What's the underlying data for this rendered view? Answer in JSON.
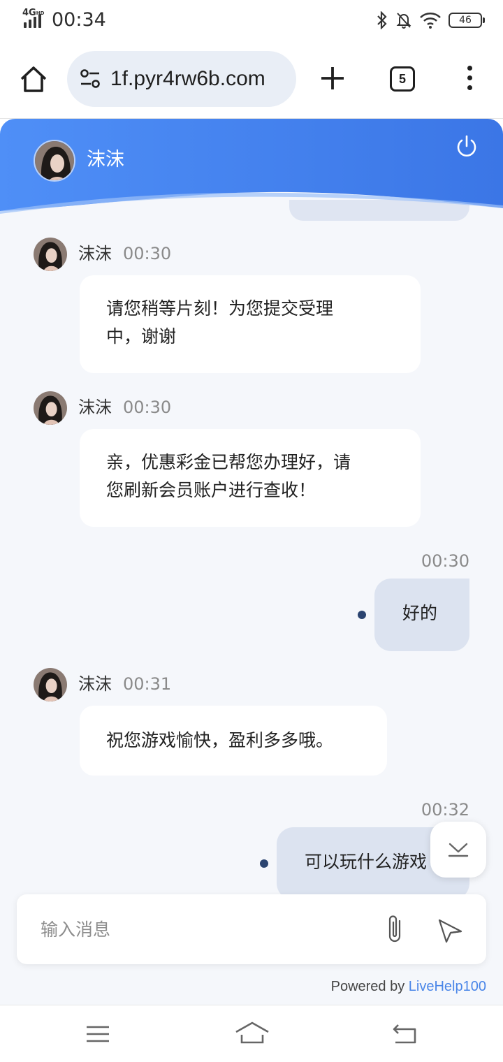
{
  "status_bar": {
    "network": "4G",
    "network_sup": "HD",
    "time": "00:34",
    "battery": "46"
  },
  "browser": {
    "url": "1f.pyr4rw6b.com",
    "tab_count": "5"
  },
  "chat": {
    "agent_name": "沫沫",
    "messages": [
      {
        "sender": "沫沫",
        "time": "00:30",
        "text": "请您稍等片刻！为您提交受理中，谢谢",
        "line1": "请您稍等片刻！为您提交受理",
        "line2": "中，谢谢"
      },
      {
        "sender": "沫沫",
        "time": "00:30",
        "text": "亲，优惠彩金已帮您办理好，请您刷新会员账户进行查收！",
        "line1": "亲，优惠彩金已帮您办理好，请",
        "line2": "您刷新会员账户进行查收！"
      },
      {
        "sender": "me",
        "time": "00:30",
        "text": "好的"
      },
      {
        "sender": "沫沫",
        "time": "00:31",
        "text": "祝您游戏愉快，盈利多多哦。"
      },
      {
        "sender": "me",
        "time": "00:32",
        "text": "可以玩什么游戏"
      }
    ],
    "input_placeholder": "输入消息",
    "powered_by": "Powered by",
    "powered_brand": "LiveHelp100"
  },
  "colors": {
    "header_gradient_start": "#4f8ff7",
    "header_gradient_end": "#3b76e6",
    "outgoing_bubble": "#dce3f0",
    "brand_link": "#4a86e8"
  },
  "icons": [
    "home-icon",
    "site-settings-icon",
    "plus-icon",
    "tabs-icon",
    "more-icon",
    "power-icon",
    "scroll-down-icon",
    "attach-icon",
    "send-icon",
    "nav-menu-icon",
    "nav-home-icon",
    "nav-back-icon"
  ]
}
